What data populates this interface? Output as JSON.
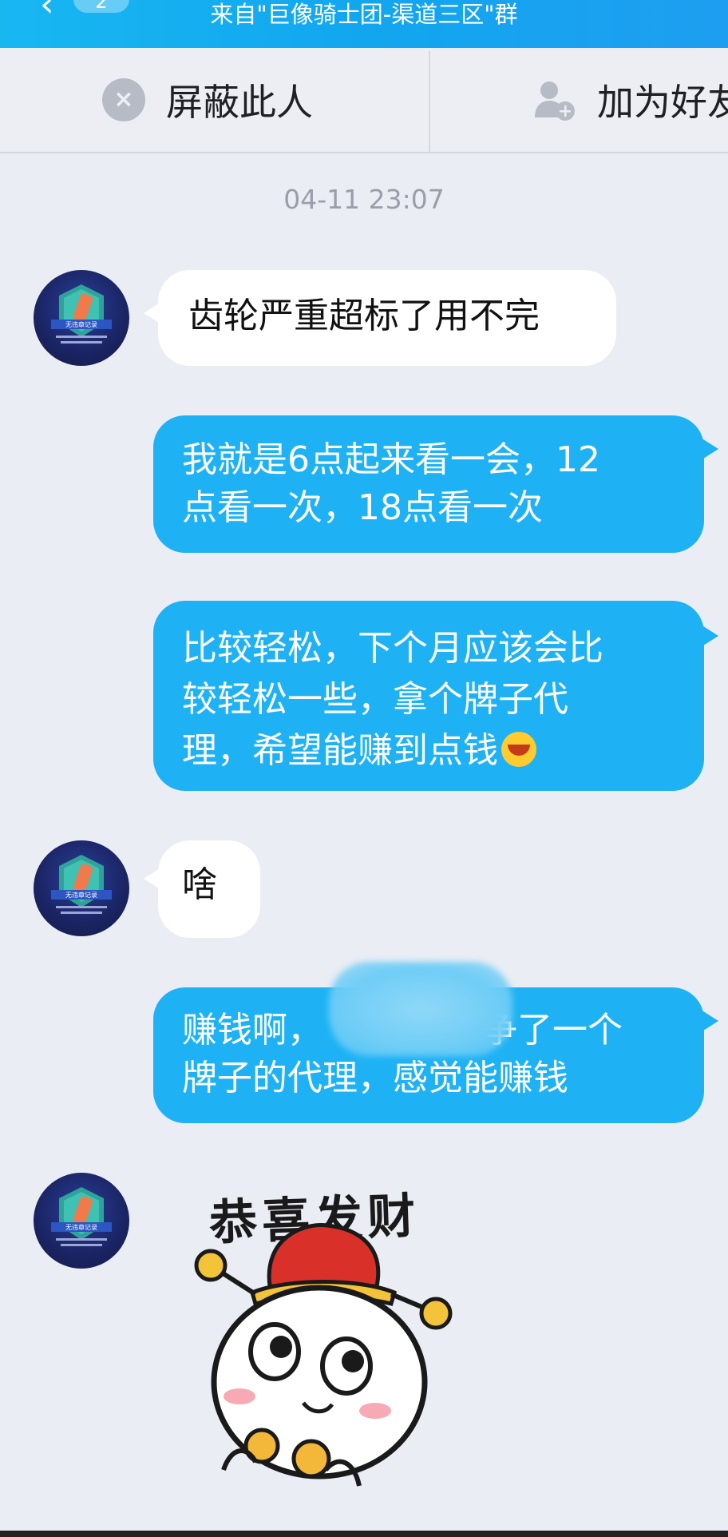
{
  "header": {
    "back_badge": "2",
    "title": "来自\"巨像骑士团-渠道三区\"群"
  },
  "actions": {
    "block_label": "屏蔽此人",
    "add_label": "加为好友"
  },
  "timestamp": "04-11 23:07",
  "messages": [
    {
      "side": "left",
      "text": "齿轮严重超标了用不完"
    },
    {
      "side": "right",
      "text": "我就是6点起来看一会，12\n点看一次，18点看一次"
    },
    {
      "side": "right",
      "text": "比较轻松，下个月应该会比\n较轻松一些，拿个牌子代\n理，希望能赚到点钱"
    },
    {
      "side": "left",
      "text": "啥"
    },
    {
      "side": "right",
      "text_a": "赚钱啊，",
      "text_b": "争了一个\n牌子的代理，感觉能赚钱"
    }
  ],
  "sticker": {
    "caption": "恭喜发财",
    "name": "god-of-wealth-sticker"
  },
  "avatar_badge_text": "无违章记录",
  "colors": {
    "header": "#18b7f2",
    "bubble_right": "#1eb2f5",
    "bubble_left": "#ffffff",
    "background": "#eaedf4"
  }
}
